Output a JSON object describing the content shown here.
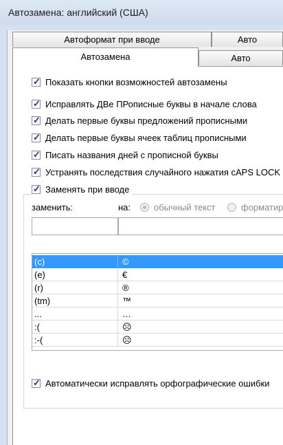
{
  "window": {
    "title": "Автозамена: английский (США)"
  },
  "tabs": [
    {
      "label": "Автоформат при вводе"
    },
    {
      "label": "Авто"
    },
    {
      "label": "Автозамена"
    },
    {
      "label": "Авто"
    }
  ],
  "options": [
    {
      "label": "Показать кнопки возможностей автозамены",
      "checked": true
    },
    {
      "label": "Исправлять ДВе ПРописные буквы в начале слова",
      "checked": true
    },
    {
      "label": "Делать первые буквы предложений прописными",
      "checked": true
    },
    {
      "label": "Делать первые буквы ячеек таблиц прописными",
      "checked": true
    },
    {
      "label": "Писать названия дней с прописной буквы",
      "checked": true
    },
    {
      "label": "Устранять последствия случайного нажатия cAPS LOCK",
      "checked": true
    }
  ],
  "replace_group": {
    "label": "Заменять при вводе",
    "checked": true,
    "replace_label": "заменить:",
    "with_label": "на:",
    "radio_plain": "обычный текст",
    "radio_formatted": "форматир",
    "replace_value": "",
    "with_value": ""
  },
  "list": [
    {
      "from": "(c)",
      "to": "©",
      "selected": true
    },
    {
      "from": "(e)",
      "to": "€",
      "selected": false
    },
    {
      "from": "(r)",
      "to": "®",
      "selected": false
    },
    {
      "from": "(tm)",
      "to": "™",
      "selected": false
    },
    {
      "from": "...",
      "to": "…",
      "selected": false
    },
    {
      "from": ":(",
      "to": "☹",
      "selected": false
    },
    {
      "from": ":-(",
      "to": "☹",
      "selected": false
    }
  ],
  "spelling": {
    "label": "Автоматически исправлять орфографические ошибки",
    "checked": true
  },
  "colors": {
    "selection": "#3399ff",
    "checkmark": "#1d3d78"
  }
}
